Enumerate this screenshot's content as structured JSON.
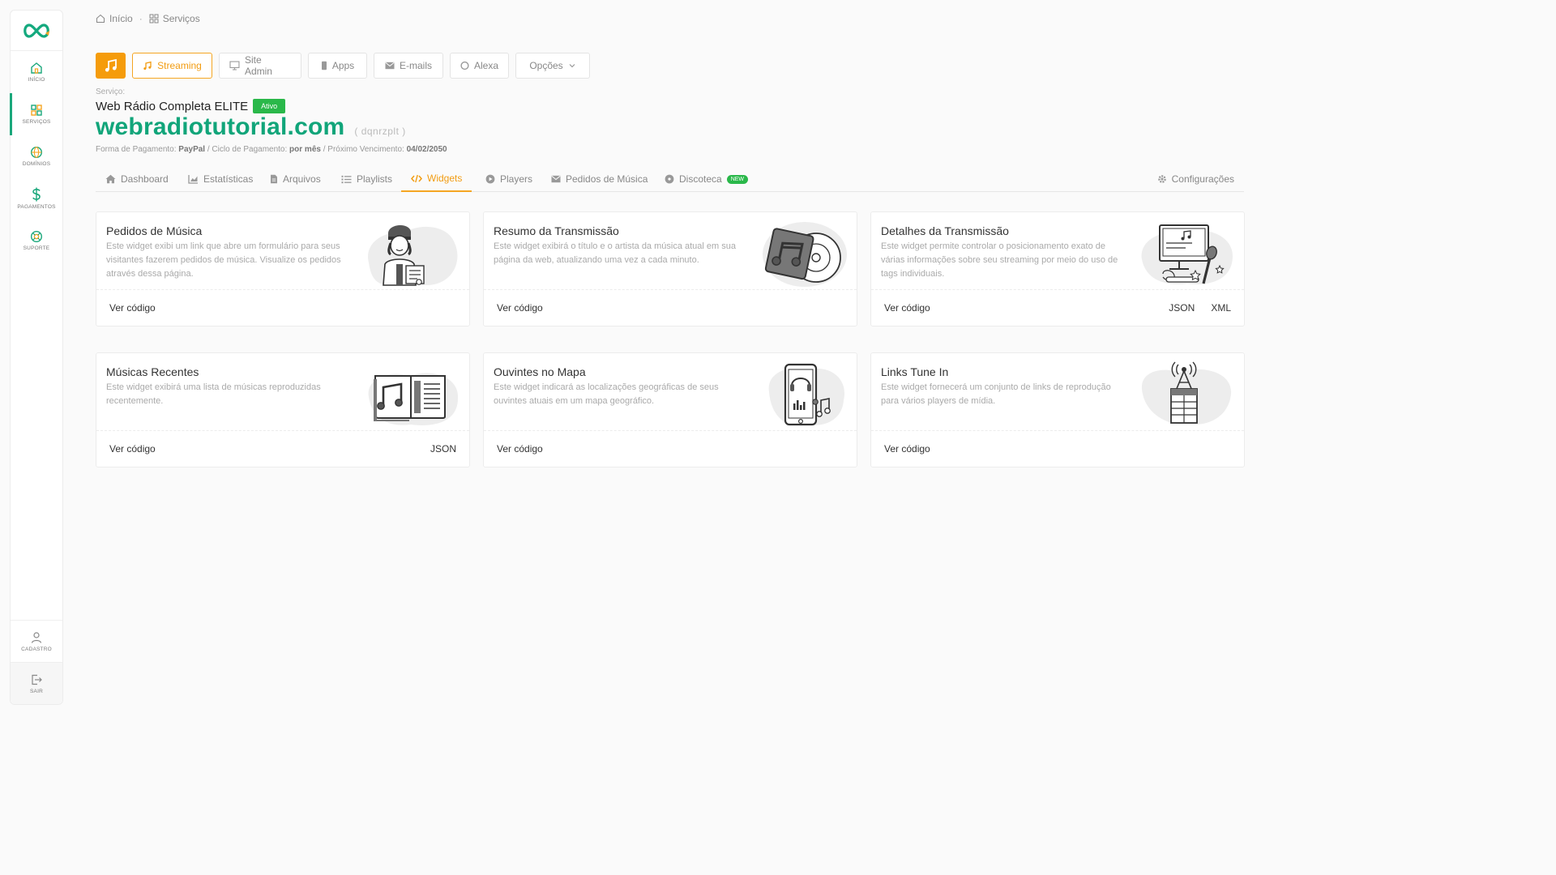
{
  "sidebar": {
    "items": [
      {
        "label": "Início",
        "icon": "home-icon",
        "active": false
      },
      {
        "label": "Serviços",
        "icon": "grid-icon",
        "active": true
      },
      {
        "label": "Domínios",
        "icon": "globe-icon",
        "active": false
      },
      {
        "label": "Pagamentos",
        "icon": "dollar-icon",
        "active": false
      },
      {
        "label": "Suporte",
        "icon": "lifebuoy-icon",
        "active": false
      }
    ],
    "profile_label": "Cadastro",
    "logout_label": "Sair"
  },
  "breadcrumb": {
    "home": "Início",
    "current": "Serviços"
  },
  "service_bar": {
    "streaming": "Streaming",
    "site_admin": "Site Admin",
    "apps": "Apps",
    "emails": "E-mails",
    "alexa": "Alexa",
    "options": "Opções"
  },
  "service": {
    "label": "Serviço:",
    "plan": "Web Rádio Completa ELITE",
    "status": "Ativo",
    "domain": "webradiotutorial.com",
    "id": "( dqnrzplt )",
    "payment_method_label": "Forma de Pagamento:",
    "payment_method": "PayPal",
    "cycle_label": "/ Ciclo de Pagamento:",
    "cycle": "por mês",
    "due_label": "/ Próximo Vencimento:",
    "due": "04/02/2050"
  },
  "tabs": {
    "dashboard": "Dashboard",
    "stats": "Estatísticas",
    "files": "Arquivos",
    "playlists": "Playlists",
    "widgets": "Widgets",
    "players": "Players",
    "requests": "Pedidos de Música",
    "discoteca": "Discoteca",
    "new_badge": "NEW",
    "settings": "Configurações"
  },
  "accent": "#f5a623",
  "brand": "#11a57a",
  "cards": [
    {
      "title": "Pedidos de Música",
      "desc": "Este widget exibi um link que abre um formulário para seus visitantes fazerem pedidos de música. Visualize os pedidos através dessa página.",
      "code": "Ver código",
      "extra1": "",
      "extra2": ""
    },
    {
      "title": "Resumo da Transmissão",
      "desc": "Este widget exibirá o título e o artista da música atual em sua página da web, atualizando uma vez a cada minuto.",
      "code": "Ver código",
      "extra1": "",
      "extra2": ""
    },
    {
      "title": "Detalhes da Transmissão",
      "desc": "Este widget permite controlar o posicionamento exato de várias informações sobre seu streaming por meio do uso de tags individuais.",
      "code": "Ver código",
      "extra1": "JSON",
      "extra2": "XML"
    },
    {
      "title": "Músicas Recentes",
      "desc": "Este widget exibirá uma lista de músicas reproduzidas recentemente.",
      "code": "Ver código",
      "extra1": "JSON",
      "extra2": ""
    },
    {
      "title": "Ouvintes no Mapa",
      "desc": "Este widget indicará as localizações geográficas de seus ouvintes atuais em um mapa geográfico.",
      "code": "Ver código",
      "extra1": "",
      "extra2": ""
    },
    {
      "title": "Links Tune In",
      "desc": "Este widget fornecerá um conjunto de links de reprodução para vários players de mídia.",
      "code": "Ver código",
      "extra1": "",
      "extra2": ""
    }
  ]
}
